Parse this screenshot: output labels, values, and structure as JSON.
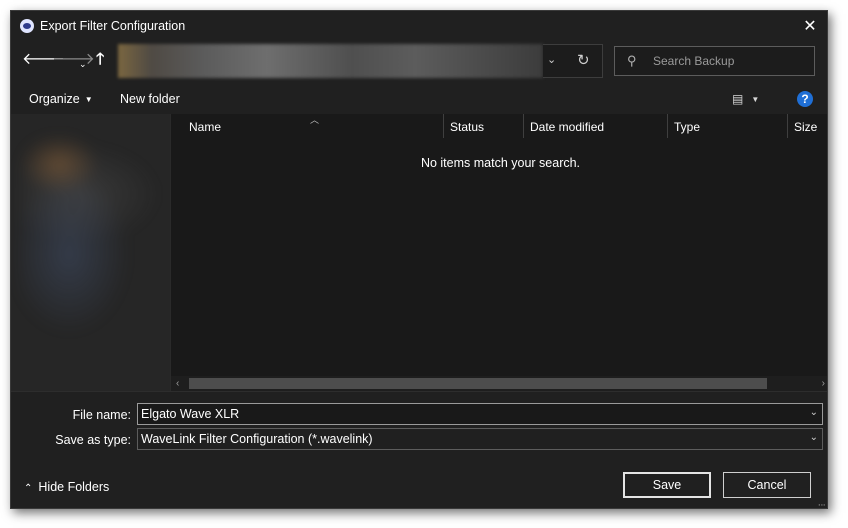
{
  "window": {
    "title": "Export Filter Configuration",
    "close_glyph": "✕"
  },
  "nav": {
    "back_glyph": "🡐",
    "forward_glyph": "🡒",
    "recent_glyph": "⌄",
    "up_glyph": "🡑",
    "address_dropdown_glyph": "⌄",
    "refresh_glyph": "↻"
  },
  "search": {
    "placeholder": "Search Backup",
    "value": ""
  },
  "commands": {
    "organize_label": "Organize",
    "new_folder_label": "New folder",
    "help_glyph": "?"
  },
  "file_list": {
    "columns": [
      "Name",
      "Status",
      "Date modified",
      "Type",
      "Size"
    ],
    "empty_message": "No items match your search."
  },
  "form": {
    "file_name_label": "File name:",
    "file_name_value": "Elgato Wave XLR",
    "save_type_label": "Save as type:",
    "save_type_value": "WaveLink Filter Configuration (*.wavelink)"
  },
  "footer": {
    "hide_folders_label": "Hide Folders",
    "save_label": "Save",
    "cancel_label": "Cancel"
  },
  "colors": {
    "background": "#202020",
    "list_background": "#191919",
    "help_icon": "#1f6fd6"
  }
}
